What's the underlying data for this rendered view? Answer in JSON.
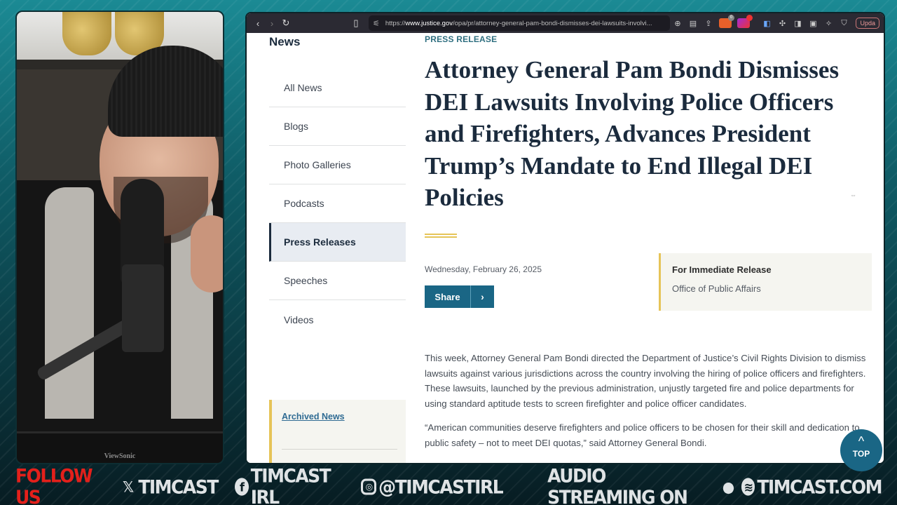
{
  "webcam": {
    "description": "Host on camera wearing black beanie speaking into microphone",
    "monitor_brand": "ViewSonic"
  },
  "browser": {
    "nav": {
      "back": "‹",
      "forward": "›",
      "reload": "↻",
      "bookmark": "🔖"
    },
    "url_prefix": "https://",
    "url_domain": "www.justice.gov",
    "url_path": "/opa/pr/attorney-general-pam-bondi-dismisses-dei-lawsuits-involvi...",
    "toolbar_icons": [
      "zoom-icon",
      "reader-icon",
      "share-icon",
      "brave-shields-icon",
      "brave-rewards-icon",
      "bitwarden-icon",
      "extensions-icon",
      "sidebar-icon",
      "wallet-icon",
      "leo-icon",
      "vpn-icon"
    ],
    "update_button": "Upda",
    "extension_badge": "0"
  },
  "sidebar": {
    "heading": "News",
    "items": [
      {
        "label": "All News",
        "active": false
      },
      {
        "label": "Blogs",
        "active": false
      },
      {
        "label": "Photo Galleries",
        "active": false
      },
      {
        "label": "Podcasts",
        "active": false
      },
      {
        "label": "Press Releases",
        "active": true
      },
      {
        "label": "Speeches",
        "active": false
      },
      {
        "label": "Videos",
        "active": false
      }
    ],
    "archive_link": "Archived News"
  },
  "article": {
    "kicker": "PRESS RELEASE",
    "title": "Attorney General Pam Bondi Dismisses DEI Lawsuits Involving Police Officers and Firefighters, Advances President Trump’s Mandate to End Illegal DEI Policies",
    "date": "Wednesday, February 26, 2025",
    "share_label": "Share",
    "share_arrow": "›",
    "release_heading": "For Immediate Release",
    "release_source": "Office of Public Affairs",
    "paragraphs": [
      "This week, Attorney General Pam Bondi directed the Department of Justice’s Civil Rights Division to dismiss lawsuits against various jurisdictions across the country involving the hiring of police officers and firefighters. These lawsuits, launched by the previous administration, unjustly targeted fire and police departments for using standard aptitude tests to screen firefighter and police officer candidates.",
      "“American communities deserve firefighters and police officers to be chosen for their skill and dedication to public safety – not to meet DEI quotas,” said Attorney General Bondi."
    ]
  },
  "top_button": {
    "chevron": "^",
    "label": "TOP"
  },
  "footer": {
    "follow": "FOLLOW US",
    "x_handle": "TIMCAST",
    "facebook_handle": "TIMCAST IRL",
    "instagram_handle": "@TIMCASTIRL",
    "audio": "AUDIO STREAMING ON",
    "site": "TIMCAST.COM"
  },
  "colors": {
    "accent_blue": "#1a6685",
    "gold": "#e6c458",
    "navy_text": "#1b2b3d",
    "follow_red": "#e3201b"
  }
}
